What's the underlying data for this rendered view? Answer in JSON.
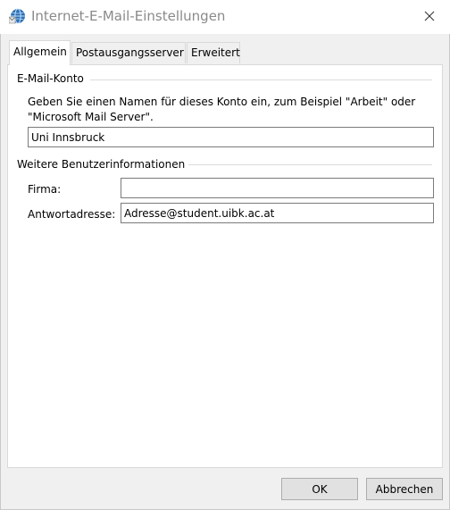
{
  "window": {
    "title": "Internet-E-Mail-Einstellungen",
    "icon": "outlook-globe-icon",
    "close_icon": "close-icon"
  },
  "tabs": [
    {
      "label": "Allgemein",
      "active": true
    },
    {
      "label": "Postausgangsserver",
      "active": false
    },
    {
      "label": "Erweitert",
      "active": false
    }
  ],
  "email_account": {
    "group_label": "E-Mail-Konto",
    "description": "Geben Sie einen Namen für dieses Konto ein, zum Beispiel \"Arbeit\" oder \"Microsoft Mail Server\".",
    "account_name_value": "Uni Innsbruck"
  },
  "user_info": {
    "group_label": "Weitere Benutzerinformationen",
    "company_label": "Firma:",
    "company_value": "",
    "reply_label": "Antwortadresse:",
    "reply_value": "Adresse@student.uibk.ac.at"
  },
  "buttons": {
    "ok": "OK",
    "cancel": "Abbrechen"
  }
}
